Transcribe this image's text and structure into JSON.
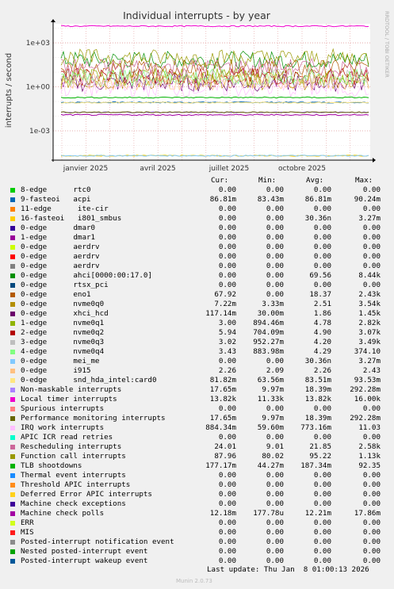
{
  "chart_data": {
    "type": "line",
    "title": "Individual interrupts - by year",
    "ylabel": "interrupts / second",
    "yscale": "log",
    "ylim": [
      1e-05,
      20000
    ],
    "yticks": [
      "1e+03",
      "1e+00",
      "1e-03"
    ],
    "xticks": [
      "janvier 2025",
      "avril 2025",
      "juillet 2025",
      "octobre 2025"
    ],
    "side_label": "RRDTOOL / TOBI OETIKER",
    "grid": true,
    "columns": [
      "Cur:",
      "Min:",
      "Avg:",
      "Max:"
    ],
    "series": [
      {
        "swatch": "#00cc00",
        "name": "8-edge      rtc0",
        "cur": "0.00",
        "min": "0.00",
        "avg": "0.00",
        "max": "0.00"
      },
      {
        "swatch": "#0066b3",
        "name": "9-fasteoi   acpi",
        "cur": "86.81m",
        "min": "83.43m",
        "avg": "86.81m",
        "max": "90.24m"
      },
      {
        "swatch": "#ff8000",
        "name": "11-edge      ite-cir",
        "cur": "0.00",
        "min": "0.00",
        "avg": "0.00",
        "max": "0.00"
      },
      {
        "swatch": "#ffcc00",
        "name": "16-fasteoi   i801_smbus",
        "cur": "0.00",
        "min": "0.00",
        "avg": "30.36n",
        "max": "3.27m"
      },
      {
        "swatch": "#330099",
        "name": "0-edge      dmar0",
        "cur": "0.00",
        "min": "0.00",
        "avg": "0.00",
        "max": "0.00"
      },
      {
        "swatch": "#990099",
        "name": "1-edge      dmar1",
        "cur": "0.00",
        "min": "0.00",
        "avg": "0.00",
        "max": "0.00"
      },
      {
        "swatch": "#ccff00",
        "name": "0-edge      aerdrv",
        "cur": "0.00",
        "min": "0.00",
        "avg": "0.00",
        "max": "0.00"
      },
      {
        "swatch": "#ff0000",
        "name": "0-edge      aerdrv",
        "cur": "0.00",
        "min": "0.00",
        "avg": "0.00",
        "max": "0.00"
      },
      {
        "swatch": "#808080",
        "name": "0-edge      aerdrv",
        "cur": "0.00",
        "min": "0.00",
        "avg": "0.00",
        "max": "0.00"
      },
      {
        "swatch": "#008f00",
        "name": "0-edge      ahci[0000:00:17.0]",
        "cur": "0.00",
        "min": "0.00",
        "avg": "69.56",
        "max": "8.44k"
      },
      {
        "swatch": "#00487d",
        "name": "0-edge      rtsx_pci",
        "cur": "0.00",
        "min": "0.00",
        "avg": "0.00",
        "max": "0.00"
      },
      {
        "swatch": "#b35a00",
        "name": "0-edge      eno1",
        "cur": "67.92",
        "min": "0.00",
        "avg": "18.37",
        "max": "2.43k"
      },
      {
        "swatch": "#b38f00",
        "name": "0-edge      nvme0q0",
        "cur": "7.22m",
        "min": "3.33m",
        "avg": "2.51",
        "max": "3.54k"
      },
      {
        "swatch": "#6b006b",
        "name": "0-edge      xhci_hcd",
        "cur": "117.14m",
        "min": "30.00m",
        "avg": "1.86",
        "max": "1.45k"
      },
      {
        "swatch": "#8fb300",
        "name": "1-edge      nvme0q1",
        "cur": "3.00",
        "min": "894.46m",
        "avg": "4.78",
        "max": "2.82k"
      },
      {
        "swatch": "#b30000",
        "name": "2-edge      nvme0q2",
        "cur": "5.94",
        "min": "704.09m",
        "avg": "4.90",
        "max": "3.07k"
      },
      {
        "swatch": "#bebebe",
        "name": "3-edge      nvme0q3",
        "cur": "3.02",
        "min": "952.27m",
        "avg": "4.20",
        "max": "3.49k"
      },
      {
        "swatch": "#80ff80",
        "name": "4-edge      nvme0q4",
        "cur": "3.43",
        "min": "883.98m",
        "avg": "4.29",
        "max": "374.10"
      },
      {
        "swatch": "#80c9ff",
        "name": "0-edge      mei_me",
        "cur": "0.00",
        "min": "0.00",
        "avg": "30.36n",
        "max": "3.27m"
      },
      {
        "swatch": "#ffc080",
        "name": "0-edge      i915",
        "cur": "2.26",
        "min": "2.09",
        "avg": "2.26",
        "max": "2.43"
      },
      {
        "swatch": "#ffe680",
        "name": "0-edge      snd_hda_intel:card0",
        "cur": "81.82m",
        "min": "63.56m",
        "avg": "83.51m",
        "max": "93.53m"
      },
      {
        "swatch": "#aa80ff",
        "name": "Non-maskable interrupts",
        "cur": "17.65m",
        "min": "9.97m",
        "avg": "18.39m",
        "max": "292.28m"
      },
      {
        "swatch": "#ee00cc",
        "name": "Local timer interrupts",
        "cur": "13.82k",
        "min": "11.33k",
        "avg": "13.82k",
        "max": "16.00k"
      },
      {
        "swatch": "#ff8080",
        "name": "Spurious interrupts",
        "cur": "0.00",
        "min": "0.00",
        "avg": "0.00",
        "max": "0.00"
      },
      {
        "swatch": "#666600",
        "name": "Performance monitoring interrupts",
        "cur": "17.65m",
        "min": "9.97m",
        "avg": "18.39m",
        "max": "292.28m"
      },
      {
        "swatch": "#ffbfff",
        "name": "IRQ work interrupts",
        "cur": "884.34m",
        "min": "59.60m",
        "avg": "773.16m",
        "max": "11.03"
      },
      {
        "swatch": "#00ffcc",
        "name": "APIC ICR read retries",
        "cur": "0.00",
        "min": "0.00",
        "avg": "0.00",
        "max": "0.00"
      },
      {
        "swatch": "#cc6699",
        "name": "Rescheduling interrupts",
        "cur": "24.01",
        "min": "9.01",
        "avg": "21.85",
        "max": "2.58k"
      },
      {
        "swatch": "#999900",
        "name": "Function call interrupts",
        "cur": "87.96",
        "min": "80.02",
        "avg": "95.22",
        "max": "1.13k"
      },
      {
        "swatch": "#00b300",
        "name": "TLB shootdowns",
        "cur": "177.17m",
        "min": "44.27m",
        "avg": "187.34m",
        "max": "92.35"
      },
      {
        "swatch": "#1a8cff",
        "name": "Thermal event interrupts",
        "cur": "0.00",
        "min": "0.00",
        "avg": "0.00",
        "max": "0.00"
      },
      {
        "swatch": "#ff8c1a",
        "name": "Threshold APIC interrupts",
        "cur": "0.00",
        "min": "0.00",
        "avg": "0.00",
        "max": "0.00"
      },
      {
        "swatch": "#ffd11a",
        "name": "Deferred Error APIC interrupts",
        "cur": "0.00",
        "min": "0.00",
        "avg": "0.00",
        "max": "0.00"
      },
      {
        "swatch": "#3d0099",
        "name": "Machine check exceptions",
        "cur": "0.00",
        "min": "0.00",
        "avg": "0.00",
        "max": "0.00"
      },
      {
        "swatch": "#a300a3",
        "name": "Machine check polls",
        "cur": "12.18m",
        "min": "177.78u",
        "avg": "12.21m",
        "max": "17.86m"
      },
      {
        "swatch": "#d1ff1a",
        "name": "ERR",
        "cur": "0.00",
        "min": "0.00",
        "avg": "0.00",
        "max": "0.00"
      },
      {
        "swatch": "#ff1a1a",
        "name": "MIS",
        "cur": "0.00",
        "min": "0.00",
        "avg": "0.00",
        "max": "0.00"
      },
      {
        "swatch": "#8c8c8c",
        "name": "Posted-interrupt notification event",
        "cur": "0.00",
        "min": "0.00",
        "avg": "0.00",
        "max": "0.00"
      },
      {
        "swatch": "#00a300",
        "name": "Nested posted-interrupt event",
        "cur": "0.00",
        "min": "0.00",
        "avg": "0.00",
        "max": "0.00"
      },
      {
        "swatch": "#005799",
        "name": "Posted-interrupt wakeup event",
        "cur": "0.00",
        "min": "0.00",
        "avg": "0.00",
        "max": "0.00"
      }
    ]
  },
  "footer": {
    "last_update": "Last update: Thu Jan  8 01:00:13 2026",
    "munin_version": "Munin 2.0.73"
  }
}
